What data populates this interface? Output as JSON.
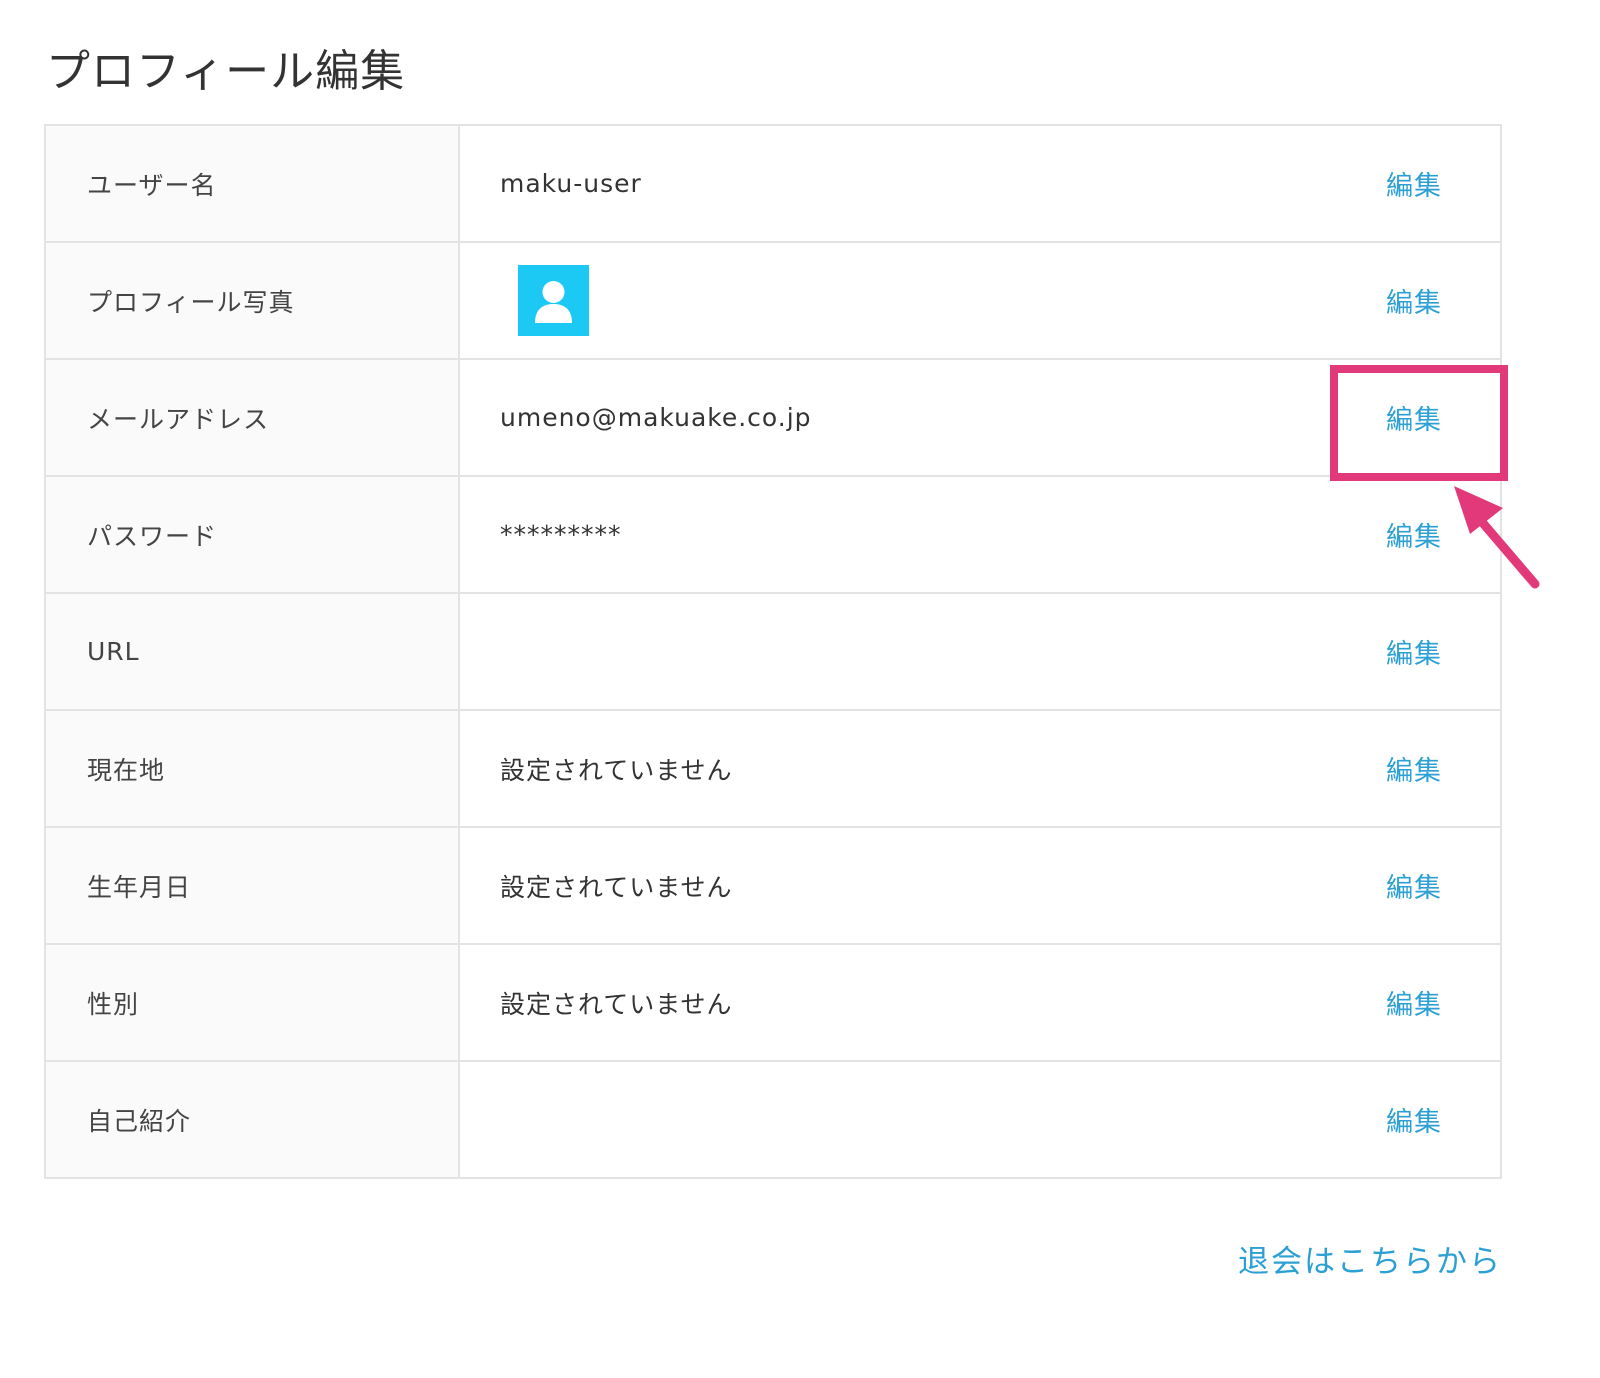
{
  "page": {
    "title": "プロフィール編集"
  },
  "rows": [
    {
      "label": "ユーザー名",
      "value": "maku-user",
      "action": "編集"
    },
    {
      "label": "プロフィール写真",
      "value": "",
      "action": "編集"
    },
    {
      "label": "メールアドレス",
      "value": "umeno@makuake.co.jp",
      "action": "編集"
    },
    {
      "label": "パスワード",
      "value": "*********",
      "action": "編集"
    },
    {
      "label": "URL",
      "value": "",
      "action": "編集"
    },
    {
      "label": "現在地",
      "value": "設定されていません",
      "action": "編集"
    },
    {
      "label": "生年月日",
      "value": "設定されていません",
      "action": "編集"
    },
    {
      "label": "性別",
      "value": "設定されていません",
      "action": "編集"
    },
    {
      "label": "自己紹介",
      "value": "",
      "action": "編集"
    }
  ],
  "footer": {
    "withdraw_label": "退会はこちらから"
  },
  "colors": {
    "link": "#2c9fd4",
    "avatar_bg": "#1cc8f4",
    "highlight": "#e2397a",
    "border": "#e3e3e3",
    "label_bg": "#fafafa"
  },
  "icons": {
    "avatar": "user-silhouette-icon",
    "annotation": "arrow-icon"
  }
}
